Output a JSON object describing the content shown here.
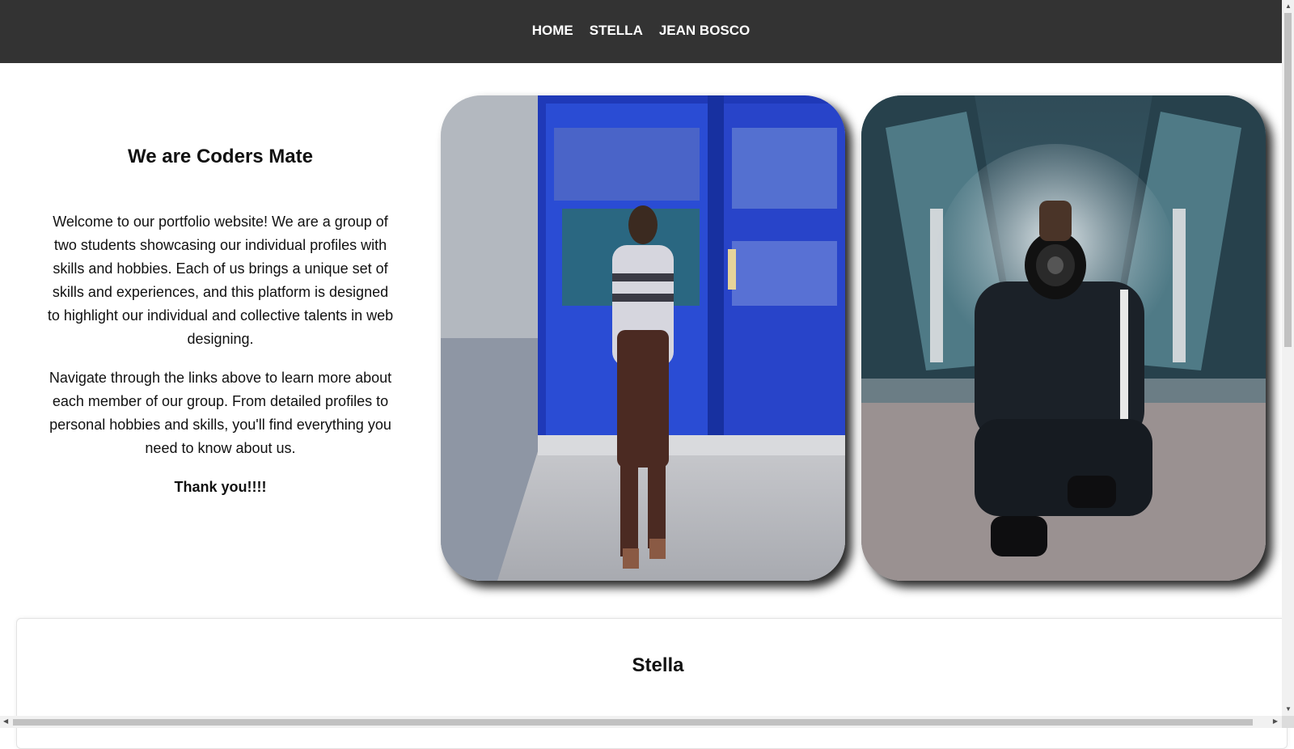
{
  "nav": {
    "home": "HOME",
    "stella": "STELLA",
    "jean_bosco": "JEAN BOSCO"
  },
  "intro": {
    "title": "We are Coders Mate",
    "paragraph1": "Welcome to our portfolio website! We are a group of two students showcasing our individual profiles with skills and hobbies. Each of us brings a unique set of skills and experiences, and this platform is designed to highlight our individual and collective talents in web designing.",
    "paragraph2": "Navigate through the links above to learn more about each member of our group. From detailed profiles to personal hobbies and skills, you'll find everything you need to know about us.",
    "thanks": "Thank you!!!!"
  },
  "photos": [
    {
      "subject": "woman-standing-at-glass-door-photo"
    },
    {
      "subject": "person-with-camera-on-escalator-photo"
    }
  ],
  "section": {
    "title": "Stella"
  },
  "colors": {
    "nav_bg": "#333333",
    "nav_text": "#ffffff",
    "page_bg": "#ffffff"
  }
}
